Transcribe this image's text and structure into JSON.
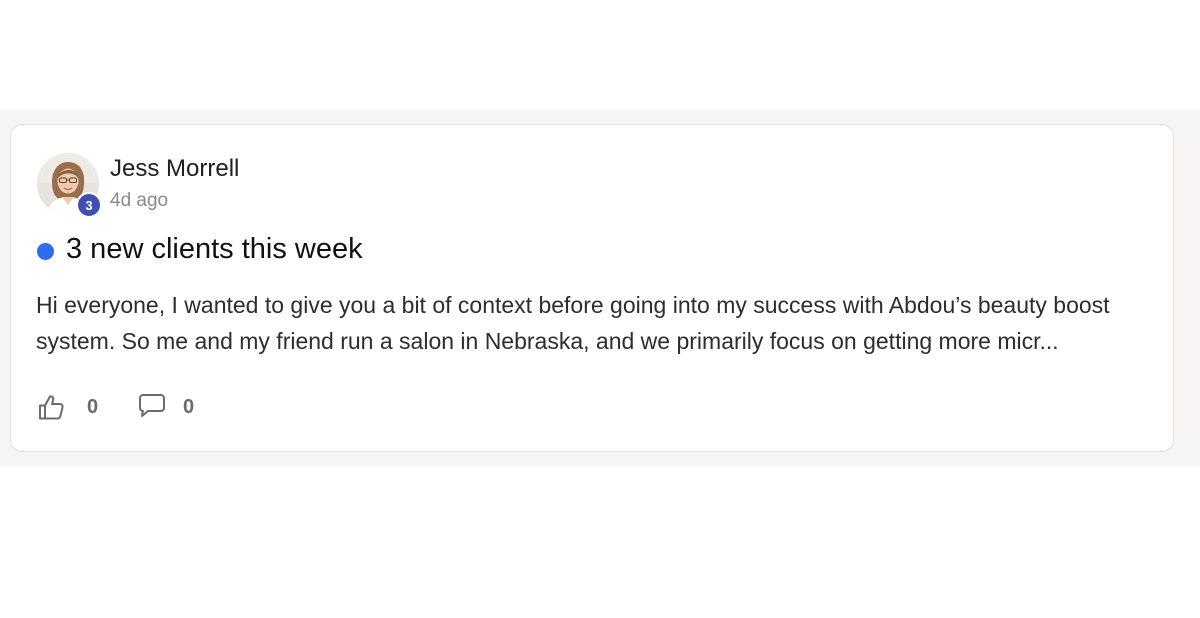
{
  "post": {
    "author": {
      "name": "Jess Morrell",
      "level": "3",
      "avatar_icon": "user-avatar-photo"
    },
    "timestamp": "4d ago",
    "unread_color": "#2f6df0",
    "title": "3 new clients this week",
    "excerpt": "Hi everyone, I wanted to give you a bit of context before going into my success with Abdou’s beauty boost system. So me and my friend run a salon in Nebraska, and we primarily focus on getting more micr...",
    "actions": {
      "like_icon": "thumbs-up-icon",
      "like_count": "0",
      "comment_icon": "comment-bubble-icon",
      "comment_count": "0"
    }
  },
  "colors": {
    "badge": "#3f4fb4",
    "page_background_band": "#f6f5f3"
  }
}
